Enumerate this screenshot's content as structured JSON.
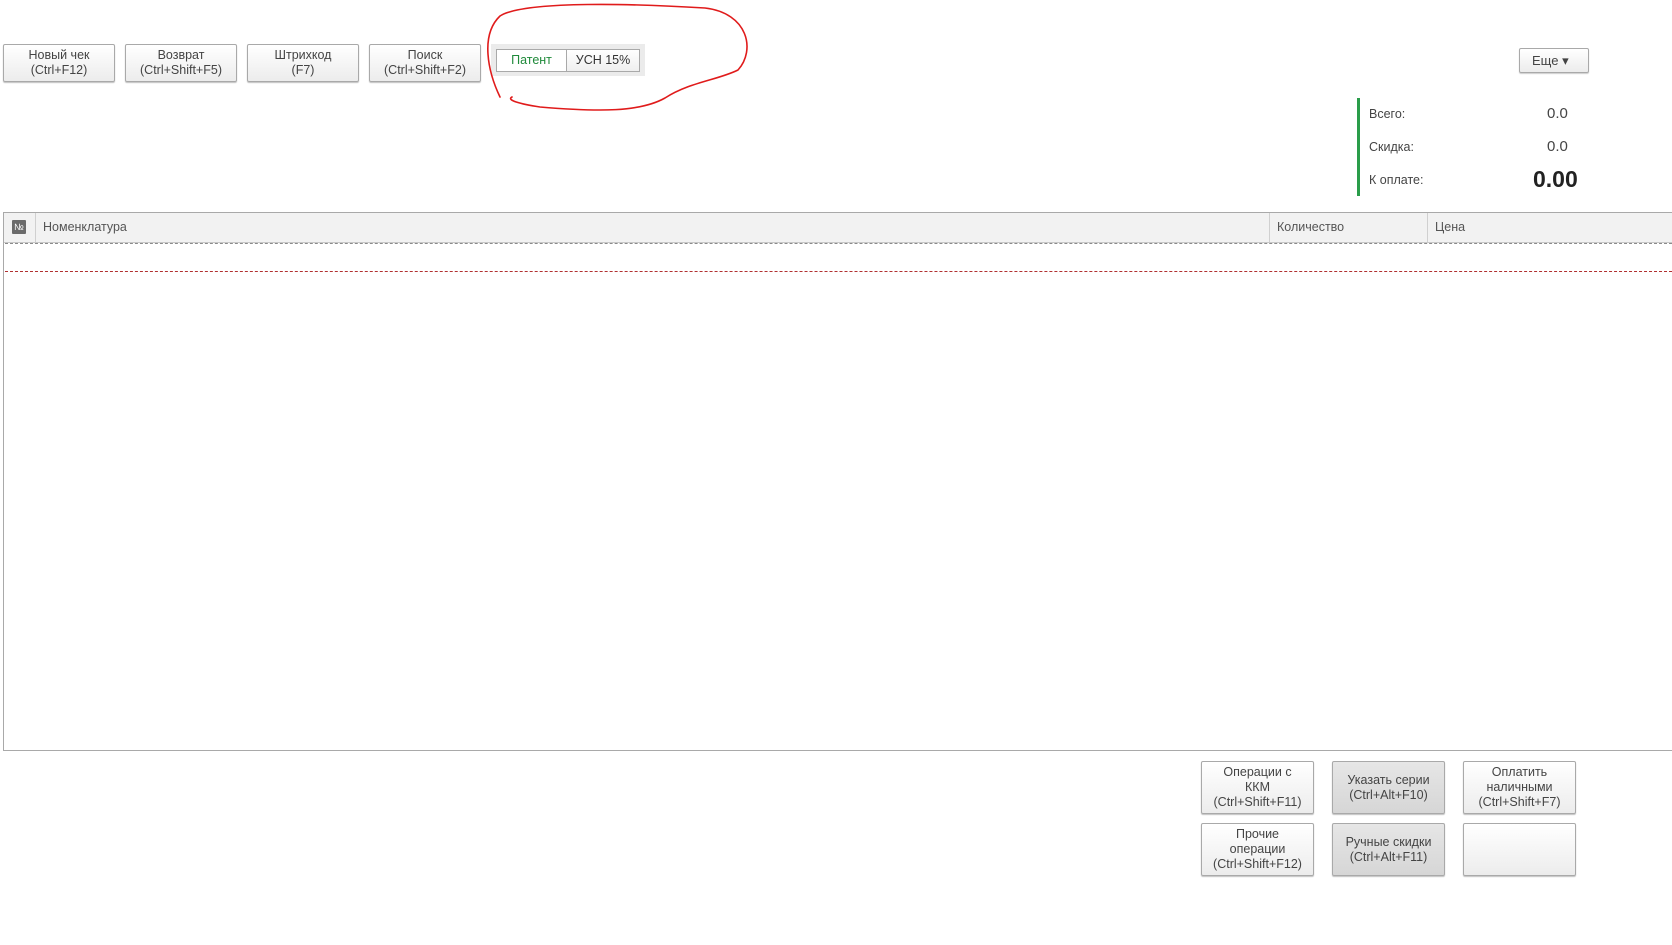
{
  "toolbar": {
    "new_receipt": "Новый чек\n(Ctrl+F12)",
    "return": "Возврат\n(Ctrl+Shift+F5)",
    "barcode": "Штрихкод\n(F7)",
    "search": "Поиск\n(Ctrl+Shift+F2)"
  },
  "tax_switch": {
    "options": [
      "Патент",
      "УСН 15%"
    ],
    "selected": "Патент"
  },
  "more_button": "Еще ▾",
  "totals": {
    "total_label": "Всего:",
    "total_value": "0.0",
    "discount_label": "Скидка:",
    "discount_value": "0.0",
    "payable_label": "К оплате:",
    "payable_value": "0.00"
  },
  "table": {
    "number_icon": "№",
    "columns": [
      "Номенклатура",
      "Количество",
      "Цена"
    ]
  },
  "actions": {
    "kkm_operations": "Операции с\nККМ\n(Ctrl+Shift+F11)",
    "specify_series": "Указать серии\n(Ctrl+Alt+F10)",
    "pay_cash": "Оплатить\nналичными\n(Ctrl+Shift+F7)",
    "other_operations": "Прочие\nоперации\n(Ctrl+Shift+F12)",
    "manual_discounts": "Ручные скидки\n(Ctrl+Alt+F11)",
    "empty": ""
  },
  "colors": {
    "accent_green": "#2a9d4a",
    "annotation_red": "#e01b1b"
  }
}
